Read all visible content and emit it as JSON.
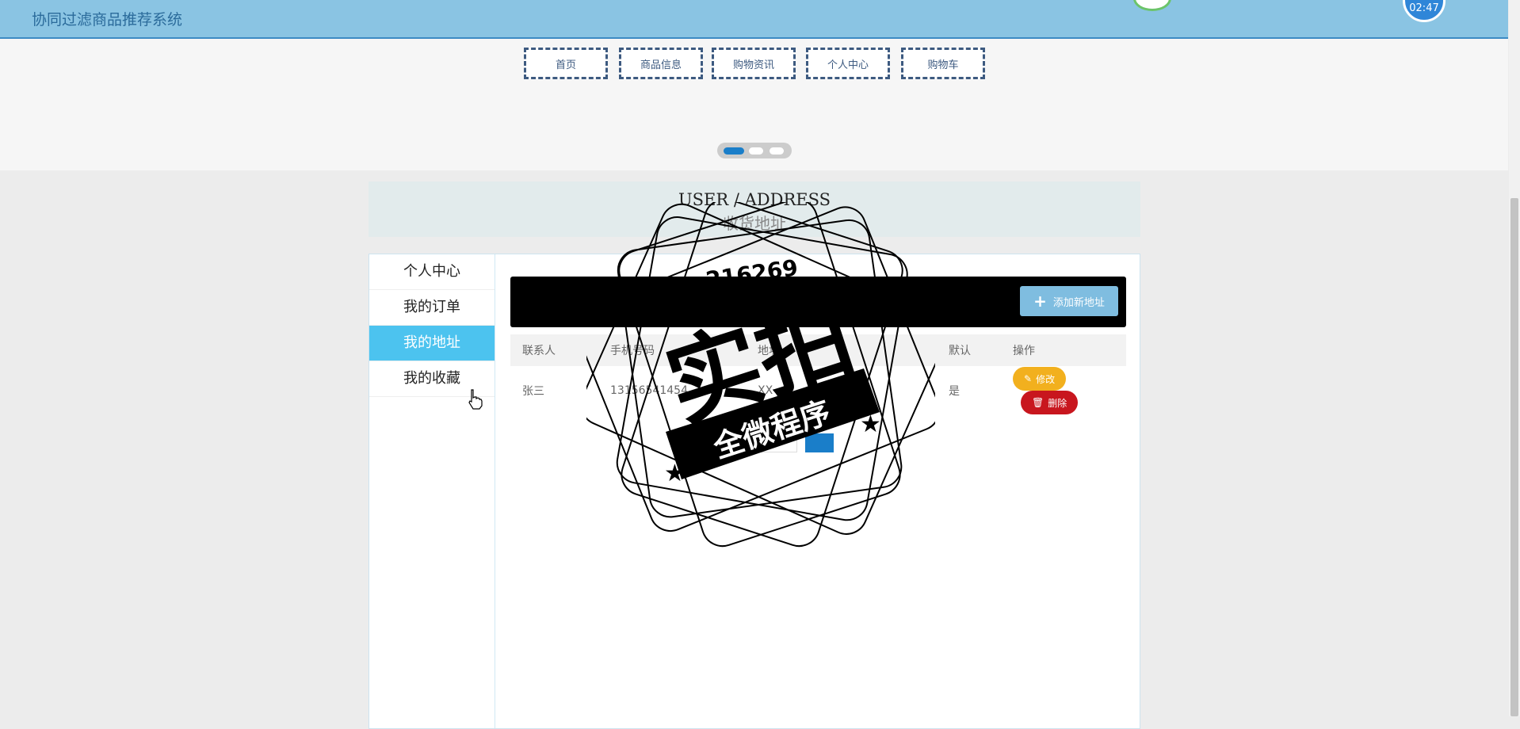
{
  "header": {
    "title": "协同过滤商品推荐系统",
    "clock": "02:47"
  },
  "nav": [
    "首页",
    "商品信息",
    "购物资讯",
    "个人中心",
    "购物车"
  ],
  "section": {
    "title_en": "USER / ADDRESS",
    "title_cn": "收货地址"
  },
  "sidebar": [
    {
      "label": "个人中心"
    },
    {
      "label": "我的订单"
    },
    {
      "label": "我的地址",
      "active": true
    },
    {
      "label": "我的收藏"
    }
  ],
  "toolbar": {
    "add_label": "添加新地址"
  },
  "table": {
    "headers": [
      "联系人",
      "手机号码",
      "地址",
      "默认",
      "操作"
    ],
    "rows": [
      {
        "contact": "张三",
        "phone": "13156541454",
        "address": "XX",
        "default": "是",
        "edit": "修改",
        "delete": "删除"
      }
    ]
  },
  "watermark": {
    "number": "216269",
    "main": "实拍",
    "sub": "全微程序"
  },
  "colors": {
    "header_bg": "#8ac4e3",
    "active_tab": "#4cc3ef",
    "edit": "#f2b01e",
    "delete": "#c8161e"
  }
}
